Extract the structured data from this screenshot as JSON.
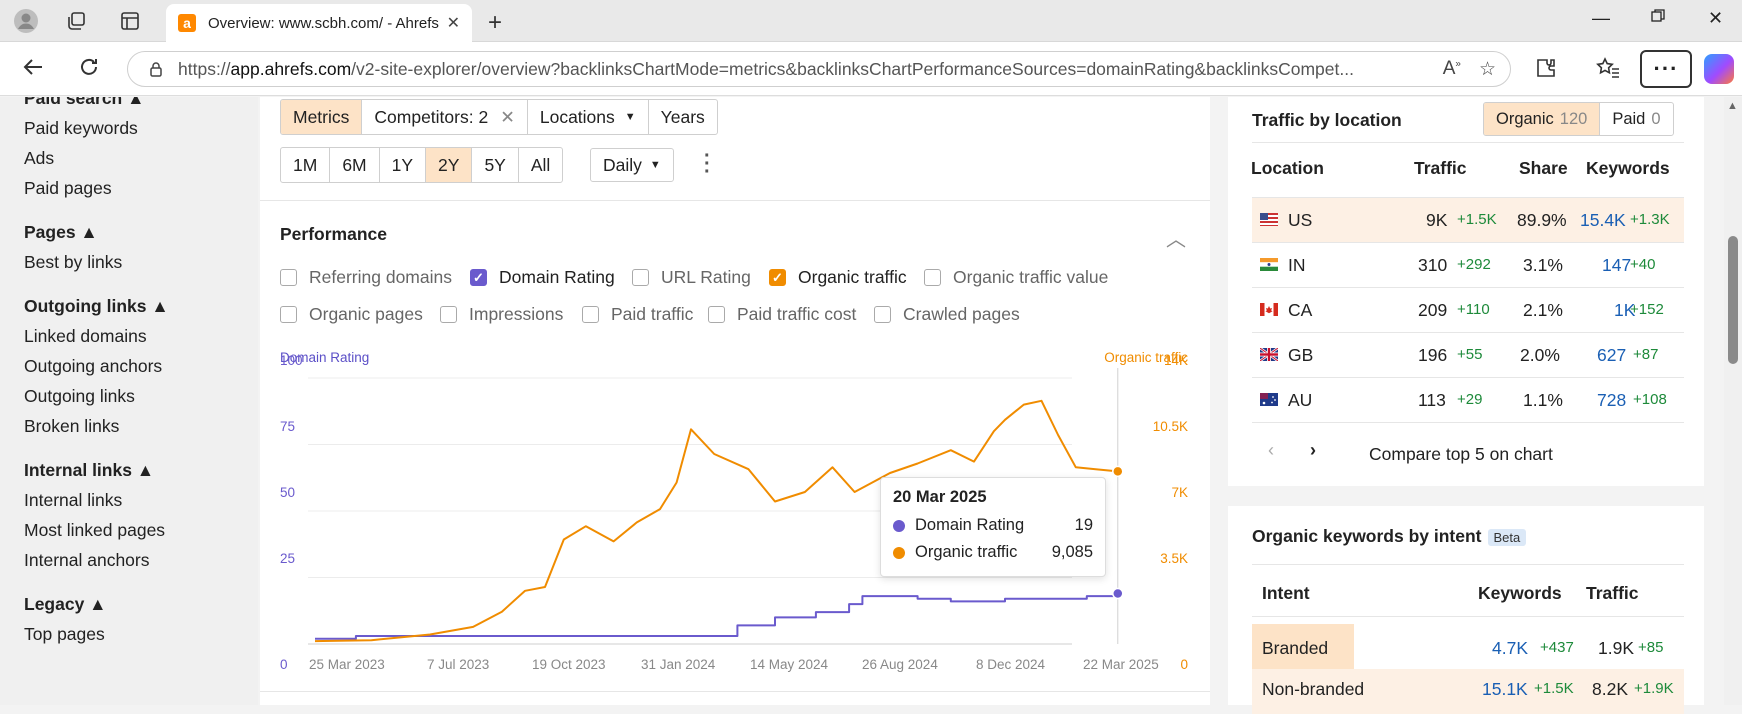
{
  "browser": {
    "tab_title": "Overview: www.scbh.com/ - Ahrefs",
    "tab_favicon": "a",
    "url_prefix": "https://",
    "url_host": "app.ahrefs.com",
    "url_rest": "/v2-site-explorer/overview?backlinksChartMode=metrics&backlinksChartPerformanceSources=domainRating&backlinksCompet..."
  },
  "sidebar": {
    "sections": [
      {
        "heading": "Paid search ▲",
        "items": [
          "Paid keywords",
          "Ads",
          "Paid pages"
        ]
      },
      {
        "heading": "Pages ▲",
        "items": [
          "Best by links"
        ]
      },
      {
        "heading": "Outgoing links ▲",
        "items": [
          "Linked domains",
          "Outgoing anchors",
          "Outgoing links",
          "Broken links"
        ]
      },
      {
        "heading": "Internal links ▲",
        "items": [
          "Internal links",
          "Most linked pages",
          "Internal anchors"
        ]
      },
      {
        "heading": "Legacy ▲",
        "items": [
          "Top pages"
        ]
      }
    ]
  },
  "toolbar": {
    "modes": [
      "Metrics",
      "Competitors: 2",
      "Locations",
      "Years"
    ],
    "ranges": [
      "1M",
      "6M",
      "1Y",
      "2Y",
      "5Y",
      "All"
    ],
    "active_range": "2Y",
    "granularity": "Daily"
  },
  "performance": {
    "title": "Performance",
    "checkboxes": [
      {
        "label": "Referring domains",
        "checked": false
      },
      {
        "label": "Domain Rating",
        "checked": true
      },
      {
        "label": "URL Rating",
        "checked": false
      },
      {
        "label": "Organic traffic",
        "checked": true
      },
      {
        "label": "Organic traffic value",
        "checked": false
      },
      {
        "label": "Organic pages",
        "checked": false
      },
      {
        "label": "Impressions",
        "checked": false
      },
      {
        "label": "Paid traffic",
        "checked": false
      },
      {
        "label": "Paid traffic cost",
        "checked": false
      },
      {
        "label": "Crawled pages",
        "checked": false
      }
    ]
  },
  "chart_data": {
    "type": "line",
    "left_axis_label": "Domain Rating",
    "right_axis_label": "Organic traffic",
    "left_ticks": [
      "100",
      "75",
      "50",
      "25",
      "0"
    ],
    "right_ticks": [
      "14K",
      "10.5K",
      "7K",
      "3.5K",
      "0"
    ],
    "x_ticks": [
      "25 Mar 2023",
      "7 Jul 2023",
      "19 Oct 2023",
      "31 Jan 2024",
      "14 May 2024",
      "26 Aug 2024",
      "8 Dec 2024",
      "22 Mar 2025"
    ],
    "ylim_left": [
      0,
      100
    ],
    "ylim_right": [
      0,
      14000
    ],
    "series": [
      {
        "name": "Domain Rating",
        "color": "#6a5acd",
        "axis": "left",
        "points": [
          [
            "2023-03-25",
            2
          ],
          [
            "2023-05-01",
            3
          ],
          [
            "2023-07-07",
            3
          ],
          [
            "2023-09-01",
            3
          ],
          [
            "2023-10-19",
            3
          ],
          [
            "2023-12-01",
            3
          ],
          [
            "2024-01-31",
            3
          ],
          [
            "2024-03-15",
            3
          ],
          [
            "2024-04-10",
            7
          ],
          [
            "2024-05-14",
            10
          ],
          [
            "2024-06-20",
            12
          ],
          [
            "2024-07-20",
            15
          ],
          [
            "2024-08-01",
            18
          ],
          [
            "2024-08-26",
            18
          ],
          [
            "2024-09-20",
            17
          ],
          [
            "2024-10-20",
            16
          ],
          [
            "2024-12-08",
            17
          ],
          [
            "2025-01-20",
            17
          ],
          [
            "2025-02-20",
            18
          ],
          [
            "2025-03-20",
            19
          ]
        ]
      },
      {
        "name": "Organic traffic",
        "color": "#f08c00",
        "axis": "right",
        "points": [
          [
            "2023-03-25",
            150
          ],
          [
            "2023-05-15",
            200
          ],
          [
            "2023-07-07",
            500
          ],
          [
            "2023-08-15",
            900
          ],
          [
            "2023-09-10",
            1700
          ],
          [
            "2023-10-01",
            2800
          ],
          [
            "2023-10-19",
            3000
          ],
          [
            "2023-11-05",
            5500
          ],
          [
            "2023-11-25",
            6200
          ],
          [
            "2023-12-20",
            5400
          ],
          [
            "2024-01-10",
            6400
          ],
          [
            "2024-01-31",
            7100
          ],
          [
            "2024-02-15",
            8500
          ],
          [
            "2024-02-28",
            11300
          ],
          [
            "2024-03-20",
            10000
          ],
          [
            "2024-04-20",
            9200
          ],
          [
            "2024-05-14",
            7500
          ],
          [
            "2024-06-10",
            8000
          ],
          [
            "2024-07-05",
            9300
          ],
          [
            "2024-07-25",
            8000
          ],
          [
            "2024-08-26",
            9000
          ],
          [
            "2024-09-20",
            9500
          ],
          [
            "2024-10-20",
            10200
          ],
          [
            "2024-11-10",
            9600
          ],
          [
            "2024-11-28",
            11200
          ],
          [
            "2024-12-08",
            11800
          ],
          [
            "2024-12-25",
            12600
          ],
          [
            "2025-01-10",
            12800
          ],
          [
            "2025-01-25",
            11000
          ],
          [
            "2025-02-10",
            9300
          ],
          [
            "2025-02-28",
            9200
          ],
          [
            "2025-03-20",
            9085
          ]
        ]
      }
    ],
    "tooltip": {
      "date": "20 Mar 2025",
      "rows": [
        {
          "label": "Domain Rating",
          "value": "19",
          "color": "#6a5acd"
        },
        {
          "label": "Organic traffic",
          "value": "9,085",
          "color": "#f08c00"
        }
      ]
    }
  },
  "traffic_by_location": {
    "title": "Traffic by location",
    "organic_label": "Organic",
    "organic_count": "120",
    "paid_label": "Paid",
    "paid_count": "0",
    "headers": [
      "Location",
      "Traffic",
      "Share",
      "Keywords"
    ],
    "rows": [
      {
        "code": "US",
        "traffic": "9K",
        "traffic_delta": "+1.5K",
        "share": "89.9%",
        "keywords": "15.4K",
        "keywords_delta": "+1.3K"
      },
      {
        "code": "IN",
        "traffic": "310",
        "traffic_delta": "+292",
        "share": "3.1%",
        "keywords": "147",
        "keywords_delta": "+40"
      },
      {
        "code": "CA",
        "traffic": "209",
        "traffic_delta": "+110",
        "share": "2.1%",
        "keywords": "1K",
        "keywords_delta": "+152"
      },
      {
        "code": "GB",
        "traffic": "196",
        "traffic_delta": "+55",
        "share": "2.0%",
        "keywords": "627",
        "keywords_delta": "+87"
      },
      {
        "code": "AU",
        "traffic": "113",
        "traffic_delta": "+29",
        "share": "1.1%",
        "keywords": "728",
        "keywords_delta": "+108"
      }
    ],
    "compare_label": "Compare top 5 on chart"
  },
  "keywords_by_intent": {
    "title": "Organic keywords by intent",
    "badge": "Beta",
    "headers": [
      "Intent",
      "Keywords",
      "Traffic"
    ],
    "rows": [
      {
        "intent": "Branded",
        "keywords": "4.7K",
        "keywords_delta": "+437",
        "traffic": "1.9K",
        "traffic_delta": "+85"
      },
      {
        "intent": "Non-branded",
        "keywords": "15.1K",
        "keywords_delta": "+1.5K",
        "traffic": "8.2K",
        "traffic_delta": "+1.9K"
      }
    ]
  }
}
